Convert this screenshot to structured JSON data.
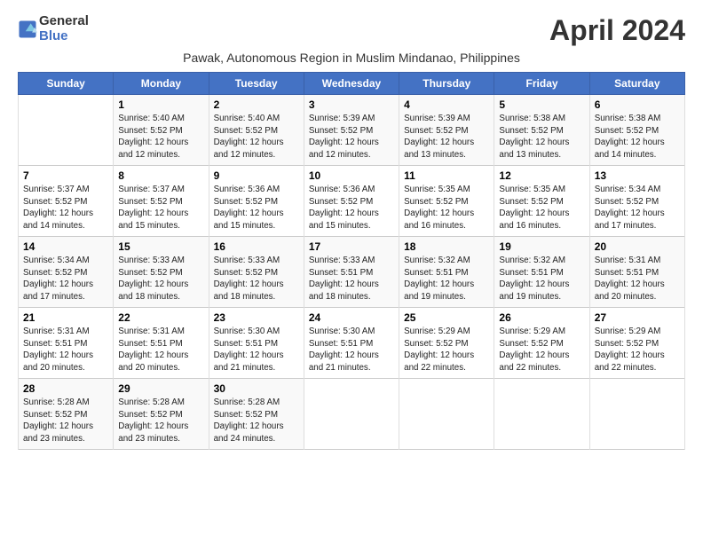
{
  "header": {
    "logo_general": "General",
    "logo_blue": "Blue",
    "month_title": "April 2024",
    "subtitle": "Pawak, Autonomous Region in Muslim Mindanao, Philippines"
  },
  "columns": [
    "Sunday",
    "Monday",
    "Tuesday",
    "Wednesday",
    "Thursday",
    "Friday",
    "Saturday"
  ],
  "weeks": [
    [
      {
        "day": "",
        "info": ""
      },
      {
        "day": "1",
        "info": "Sunrise: 5:40 AM\nSunset: 5:52 PM\nDaylight: 12 hours\nand 12 minutes."
      },
      {
        "day": "2",
        "info": "Sunrise: 5:40 AM\nSunset: 5:52 PM\nDaylight: 12 hours\nand 12 minutes."
      },
      {
        "day": "3",
        "info": "Sunrise: 5:39 AM\nSunset: 5:52 PM\nDaylight: 12 hours\nand 12 minutes."
      },
      {
        "day": "4",
        "info": "Sunrise: 5:39 AM\nSunset: 5:52 PM\nDaylight: 12 hours\nand 13 minutes."
      },
      {
        "day": "5",
        "info": "Sunrise: 5:38 AM\nSunset: 5:52 PM\nDaylight: 12 hours\nand 13 minutes."
      },
      {
        "day": "6",
        "info": "Sunrise: 5:38 AM\nSunset: 5:52 PM\nDaylight: 12 hours\nand 14 minutes."
      }
    ],
    [
      {
        "day": "7",
        "info": "Sunrise: 5:37 AM\nSunset: 5:52 PM\nDaylight: 12 hours\nand 14 minutes."
      },
      {
        "day": "8",
        "info": "Sunrise: 5:37 AM\nSunset: 5:52 PM\nDaylight: 12 hours\nand 15 minutes."
      },
      {
        "day": "9",
        "info": "Sunrise: 5:36 AM\nSunset: 5:52 PM\nDaylight: 12 hours\nand 15 minutes."
      },
      {
        "day": "10",
        "info": "Sunrise: 5:36 AM\nSunset: 5:52 PM\nDaylight: 12 hours\nand 15 minutes."
      },
      {
        "day": "11",
        "info": "Sunrise: 5:35 AM\nSunset: 5:52 PM\nDaylight: 12 hours\nand 16 minutes."
      },
      {
        "day": "12",
        "info": "Sunrise: 5:35 AM\nSunset: 5:52 PM\nDaylight: 12 hours\nand 16 minutes."
      },
      {
        "day": "13",
        "info": "Sunrise: 5:34 AM\nSunset: 5:52 PM\nDaylight: 12 hours\nand 17 minutes."
      }
    ],
    [
      {
        "day": "14",
        "info": "Sunrise: 5:34 AM\nSunset: 5:52 PM\nDaylight: 12 hours\nand 17 minutes."
      },
      {
        "day": "15",
        "info": "Sunrise: 5:33 AM\nSunset: 5:52 PM\nDaylight: 12 hours\nand 18 minutes."
      },
      {
        "day": "16",
        "info": "Sunrise: 5:33 AM\nSunset: 5:52 PM\nDaylight: 12 hours\nand 18 minutes."
      },
      {
        "day": "17",
        "info": "Sunrise: 5:33 AM\nSunset: 5:51 PM\nDaylight: 12 hours\nand 18 minutes."
      },
      {
        "day": "18",
        "info": "Sunrise: 5:32 AM\nSunset: 5:51 PM\nDaylight: 12 hours\nand 19 minutes."
      },
      {
        "day": "19",
        "info": "Sunrise: 5:32 AM\nSunset: 5:51 PM\nDaylight: 12 hours\nand 19 minutes."
      },
      {
        "day": "20",
        "info": "Sunrise: 5:31 AM\nSunset: 5:51 PM\nDaylight: 12 hours\nand 20 minutes."
      }
    ],
    [
      {
        "day": "21",
        "info": "Sunrise: 5:31 AM\nSunset: 5:51 PM\nDaylight: 12 hours\nand 20 minutes."
      },
      {
        "day": "22",
        "info": "Sunrise: 5:31 AM\nSunset: 5:51 PM\nDaylight: 12 hours\nand 20 minutes."
      },
      {
        "day": "23",
        "info": "Sunrise: 5:30 AM\nSunset: 5:51 PM\nDaylight: 12 hours\nand 21 minutes."
      },
      {
        "day": "24",
        "info": "Sunrise: 5:30 AM\nSunset: 5:51 PM\nDaylight: 12 hours\nand 21 minutes."
      },
      {
        "day": "25",
        "info": "Sunrise: 5:29 AM\nSunset: 5:52 PM\nDaylight: 12 hours\nand 22 minutes."
      },
      {
        "day": "26",
        "info": "Sunrise: 5:29 AM\nSunset: 5:52 PM\nDaylight: 12 hours\nand 22 minutes."
      },
      {
        "day": "27",
        "info": "Sunrise: 5:29 AM\nSunset: 5:52 PM\nDaylight: 12 hours\nand 22 minutes."
      }
    ],
    [
      {
        "day": "28",
        "info": "Sunrise: 5:28 AM\nSunset: 5:52 PM\nDaylight: 12 hours\nand 23 minutes."
      },
      {
        "day": "29",
        "info": "Sunrise: 5:28 AM\nSunset: 5:52 PM\nDaylight: 12 hours\nand 23 minutes."
      },
      {
        "day": "30",
        "info": "Sunrise: 5:28 AM\nSunset: 5:52 PM\nDaylight: 12 hours\nand 24 minutes."
      },
      {
        "day": "",
        "info": ""
      },
      {
        "day": "",
        "info": ""
      },
      {
        "day": "",
        "info": ""
      },
      {
        "day": "",
        "info": ""
      }
    ]
  ]
}
